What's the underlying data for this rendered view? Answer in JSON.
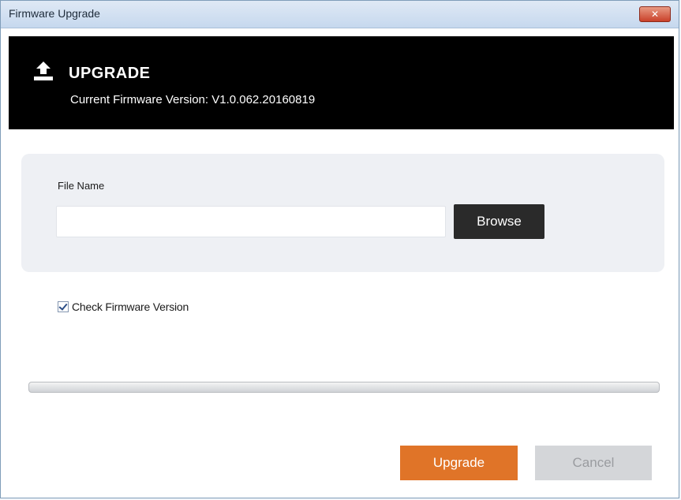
{
  "window": {
    "title": "Firmware Upgrade",
    "close_label": "✕"
  },
  "header": {
    "icon": "upload-icon",
    "title": "UPGRADE",
    "version_text": "Current Firmware Version: V1.0.062.20160819"
  },
  "file": {
    "label": "File Name",
    "value": "",
    "placeholder": "",
    "browse_label": "Browse"
  },
  "options": {
    "check_firmware_label": "Check Firmware Version",
    "check_firmware_checked": true
  },
  "progress": {
    "value": 0
  },
  "actions": {
    "upgrade_label": "Upgrade",
    "cancel_label": "Cancel"
  },
  "colors": {
    "accent": "#e07428",
    "header_bg": "#000000",
    "browse_bg": "#2a2a2a",
    "disabled_bg": "#d4d6d9"
  }
}
